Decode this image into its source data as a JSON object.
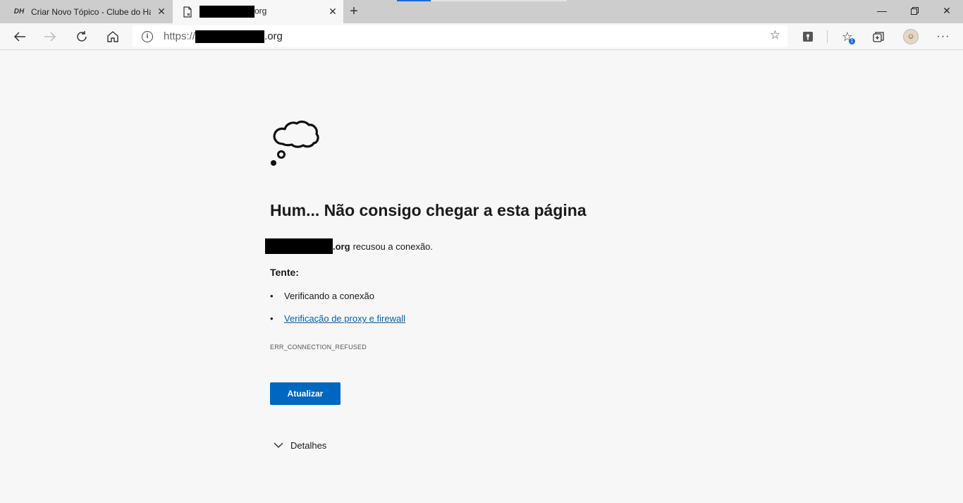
{
  "tabs": [
    {
      "favicon": "DH",
      "title": "Criar Novo Tópico - Clube do Ha",
      "active": false
    },
    {
      "favicon": "page-error-icon",
      "title_suffix": "org",
      "active": true
    }
  ],
  "toolbar": {
    "url_protocol": "https://",
    "url_suffix": ".org"
  },
  "error": {
    "heading": "Hum... Não consigo chegar a esta página",
    "host_suffix": ".org",
    "host_message": "recusou a conexão.",
    "try_label": "Tente:",
    "suggestions": [
      "Verificando a conexão",
      "Verificação de proxy e firewall"
    ],
    "code": "ERR_CONNECTION_REFUSED",
    "refresh_label": "Atualizar",
    "details_label": "Detalhes"
  },
  "colors": {
    "accent": "#0067c0",
    "link": "#0b5ea8",
    "tabstrip": "#cdcdcd",
    "page_bg": "#f7f7f7"
  }
}
